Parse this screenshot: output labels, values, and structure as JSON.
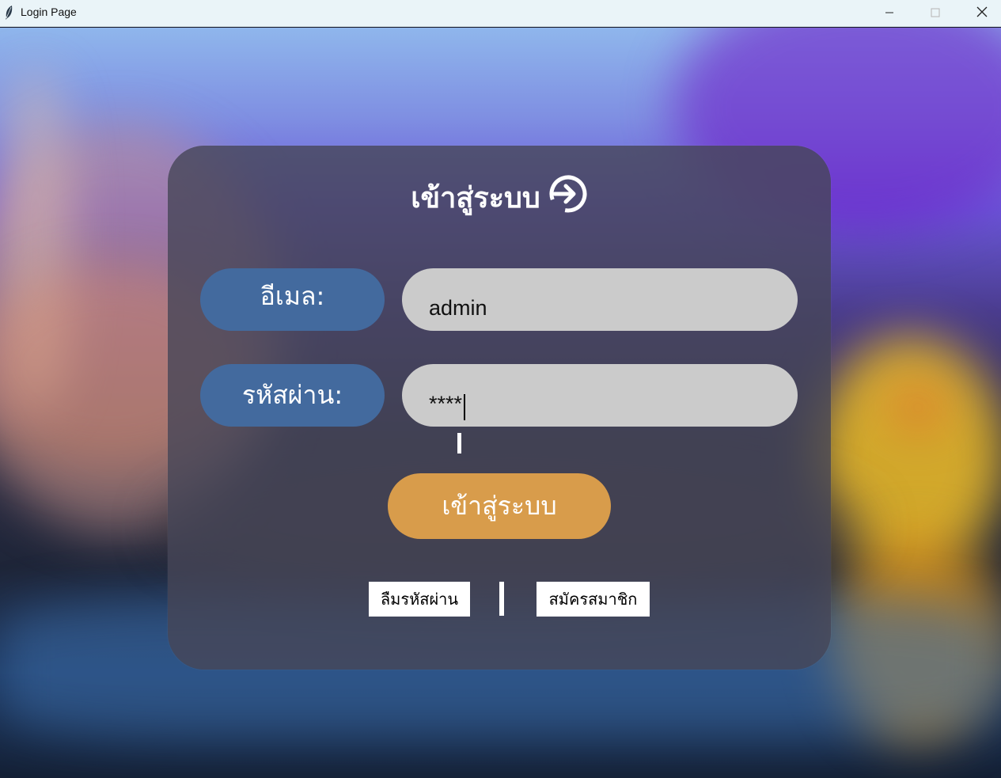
{
  "window": {
    "title": "Login Page",
    "controls": {
      "minimize_icon": "minimize-icon",
      "maximize_icon": "maximize-icon",
      "close_icon": "close-icon"
    }
  },
  "login": {
    "heading": "เข้าสู่ระบบ",
    "heading_icon": "login-arrow-icon",
    "email_label": "อีเมล:",
    "email_value": "admin",
    "password_label": "รหัสผ่าน:",
    "password_value": "****",
    "submit_label": "เข้าสู่ระบบ",
    "forgot_label": "ลืมรหัสผ่าน",
    "register_label": "สมัครสมาชิก"
  },
  "colors": {
    "label_bg": "#436a9e",
    "field_bg": "#cbcbcb",
    "button_bg": "#d89c4b",
    "card_bg": "#464658"
  }
}
